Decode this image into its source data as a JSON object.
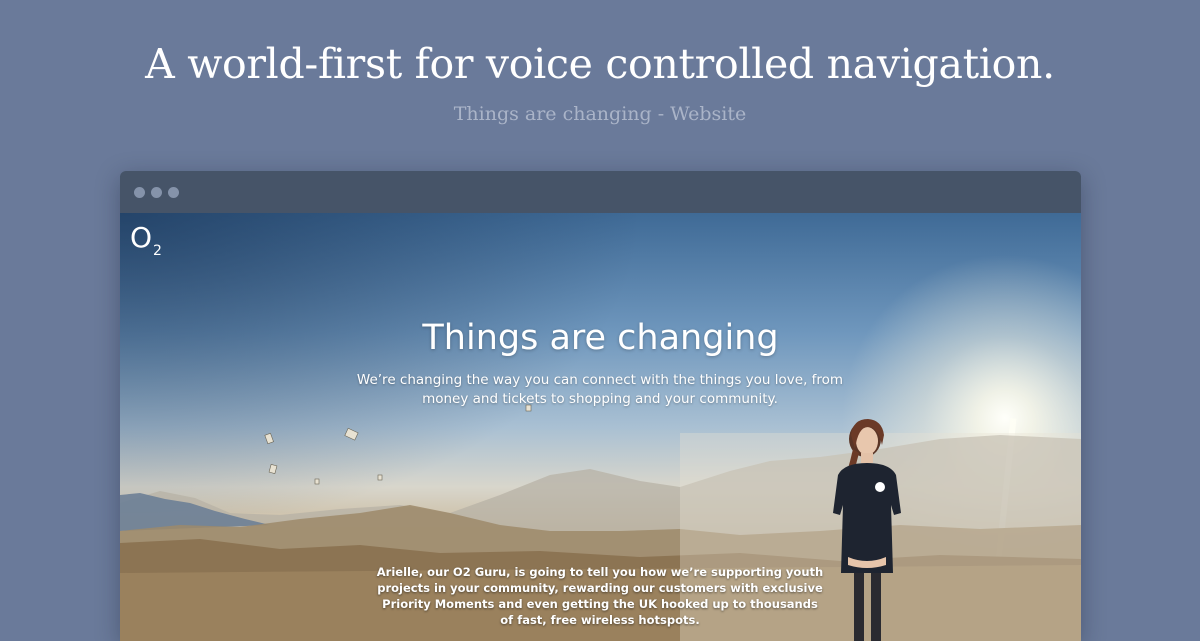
{
  "header": {
    "headline": "A world-first for voice controlled navigation.",
    "subline": "Things are changing - Website"
  },
  "site": {
    "logo": "O",
    "logo_sub": "2",
    "hero_title": "Things are changing",
    "hero_text": "We’re changing the way you can connect with the things you love, from money and tickets to shopping and your community.",
    "guru_text": "Arielle, our O2 Guru, is going to tell you how we’re supporting youth projects in your community, rewarding our customers with exclusive Priority Moments and even getting the UK hooked up to thousands of fast, free wireless hotspots."
  },
  "colors": {
    "page_background": "#6a7a9a",
    "browser_bar": "#465468",
    "browser_dot": "#8593aa",
    "headline": "#ffffff",
    "subline": "#aab4c8"
  },
  "icons": {
    "browser_dots": [
      "window-dot-icon",
      "window-dot-icon",
      "window-dot-icon"
    ]
  }
}
